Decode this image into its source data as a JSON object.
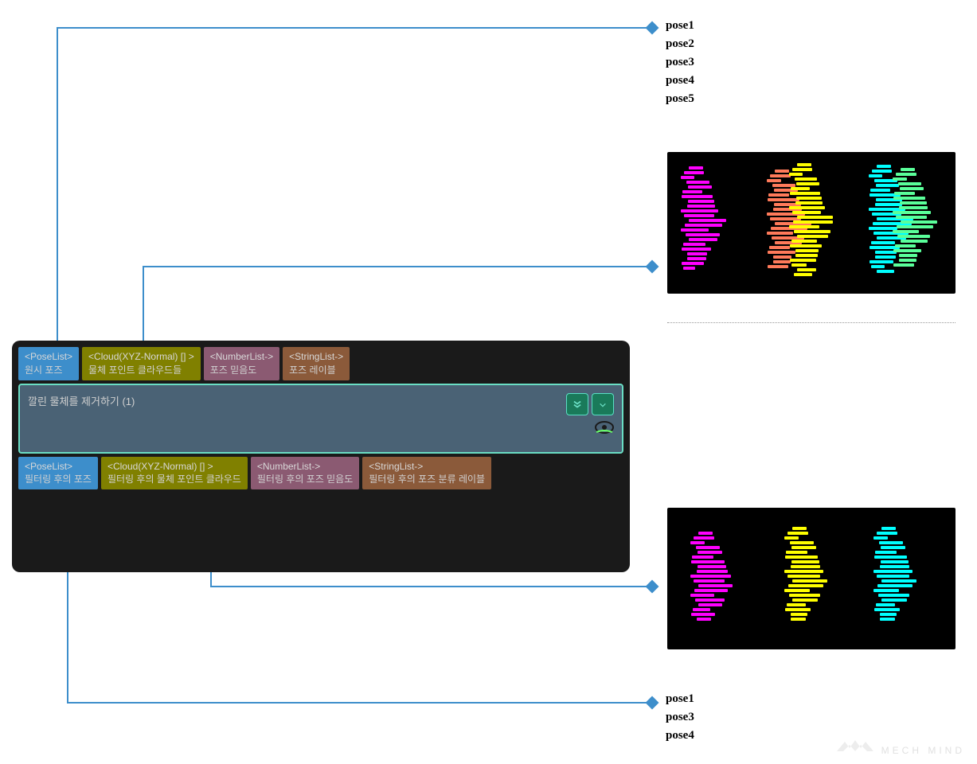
{
  "node": {
    "title": "깔린 물체를 제거하기 (1)",
    "inputs": [
      {
        "type": "<PoseList>",
        "label": "원시 포즈",
        "color": "blue"
      },
      {
        "type": "<Cloud(XYZ-Normal) [] >",
        "label": "물체 포인트 클라우드들",
        "color": "olive"
      },
      {
        "type": "<NumberList->",
        "label": "포즈 믿음도",
        "color": "plum"
      },
      {
        "type": "<StringList->",
        "label": "포즈 레이블",
        "color": "brown"
      }
    ],
    "outputs": [
      {
        "type": "<PoseList>",
        "label": "필터링 후의 포즈",
        "color": "blue"
      },
      {
        "type": "<Cloud(XYZ-Normal) [] >",
        "label": "필터링 후의 물체 포인트 클라우드",
        "color": "olive"
      },
      {
        "type": "<NumberList->",
        "label": "필터링 후의 포즈 믿음도",
        "color": "plum"
      },
      {
        "type": "<StringList->",
        "label": "필터링 후의 포즈 분류 레이블",
        "color": "brown"
      }
    ]
  },
  "poses_top": [
    "pose1",
    "pose2",
    "pose3",
    "pose4",
    "pose5"
  ],
  "poses_bottom": [
    "pose1",
    "pose3",
    "pose4"
  ],
  "watermark": "MECH MIND",
  "colors": {
    "connector": "#3d8ecb",
    "magenta": "#ff00ff",
    "salmon": "#ff7a5a",
    "yellow": "#ffff00",
    "cyan": "#00ffff",
    "green": "#5aff9a"
  }
}
